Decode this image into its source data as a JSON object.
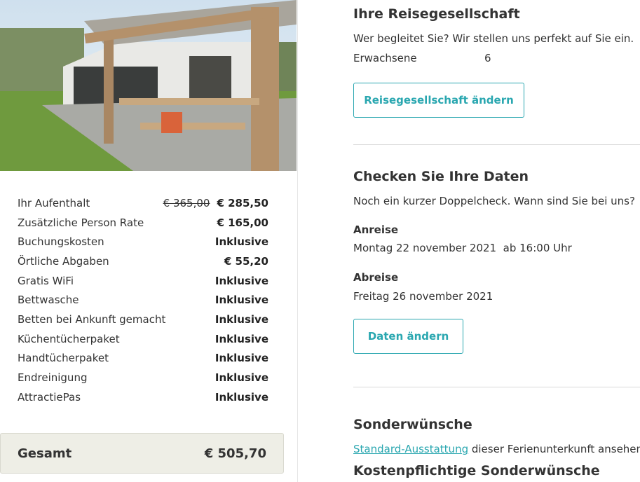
{
  "summary": {
    "rows": [
      {
        "label": "Ihr Aufenthalt",
        "old_price": "€ 365,00",
        "value": "€ 285,50"
      },
      {
        "label": "Zusätzliche Person Rate",
        "old_price": "",
        "value": "€ 165,00"
      },
      {
        "label": "Buchungskosten",
        "old_price": "",
        "value": "Inklusive"
      },
      {
        "label": "Örtliche Abgaben",
        "old_price": "",
        "value": "€ 55,20"
      },
      {
        "label": "Gratis WiFi",
        "old_price": "",
        "value": "Inklusive"
      },
      {
        "label": "Bettwasche",
        "old_price": "",
        "value": "Inklusive"
      },
      {
        "label": "Betten bei Ankunft gemacht",
        "old_price": "",
        "value": "Inklusive"
      },
      {
        "label": "Küchentücherpaket",
        "old_price": "",
        "value": "Inklusive"
      },
      {
        "label": "Handtücherpaket",
        "old_price": "",
        "value": "Inklusive"
      },
      {
        "label": "Endreinigung",
        "old_price": "",
        "value": "Inklusive"
      },
      {
        "label": "AttractiePas",
        "old_price": "",
        "value": "Inklusive"
      }
    ],
    "total_label": "Gesamt",
    "total_value": "€ 505,70"
  },
  "party": {
    "title": "Ihre Reisegesellschaft",
    "subtitle": "Wer begleitet Sie? Wir stellen uns perfekt auf Sie ein.",
    "adults_label": "Erwachsene",
    "adults_value": "6",
    "button": "Reisegesellschaft ändern"
  },
  "dates": {
    "title": "Checken Sie Ihre Daten",
    "subtitle": "Noch ein kurzer Doppelcheck. Wann sind Sie bei uns?",
    "arrival_label": "Anreise",
    "arrival_date": "Montag 22 november 2021",
    "arrival_time": "ab 16:00 Uhr",
    "departure_label": "Abreise",
    "departure_date": "Freitag 26 november 2021",
    "button": "Daten ändern"
  },
  "special": {
    "title": "Sonderwünsche",
    "link_text": "Standard-Ausstattung",
    "link_suffix": " dieser Ferienunterkunft ansehen.",
    "paid_title": "Kostenpflichtige Sonderwünsche"
  },
  "colors": {
    "accent": "#2aa7b0",
    "total_bg": "#eeeee6"
  }
}
